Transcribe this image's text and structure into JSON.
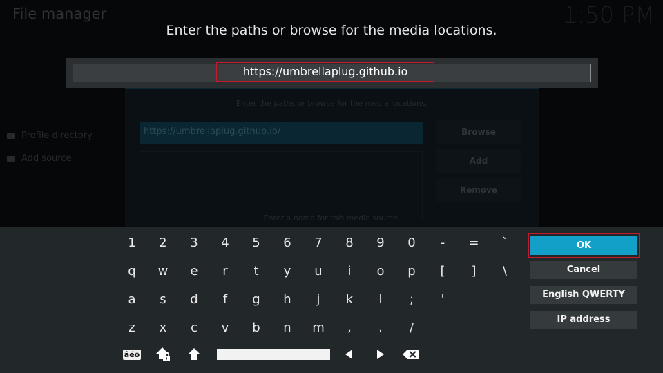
{
  "background": {
    "app_title": "File manager",
    "clock": "1:50 PM",
    "sidebar": [
      {
        "label": "Profile directory",
        "icon": "folder-icon"
      },
      {
        "label": "Add source",
        "icon": "folder-icon"
      }
    ],
    "dialog": {
      "hint": "Enter the paths or browse for the media locations.",
      "path": "https://umbrellaplug.github.io/",
      "buttons": {
        "browse": "Browse",
        "add": "Add",
        "remove": "Remove"
      },
      "name_hint": "Enter a name for this media source."
    }
  },
  "input": {
    "heading": "Enter the paths or browse for the media locations.",
    "value": "https://umbrellaplug.github.io"
  },
  "keyboard": {
    "rows": [
      [
        "1",
        "2",
        "3",
        "4",
        "5",
        "6",
        "7",
        "8",
        "9",
        "0",
        "-",
        "=",
        "`"
      ],
      [
        "q",
        "w",
        "e",
        "r",
        "t",
        "y",
        "u",
        "i",
        "o",
        "p",
        "[",
        "]",
        "\\"
      ],
      [
        "a",
        "s",
        "d",
        "f",
        "g",
        "h",
        "j",
        "k",
        "l",
        ";",
        "'"
      ],
      [
        "z",
        "x",
        "c",
        "v",
        "b",
        "n",
        "m",
        ",",
        ".",
        "/"
      ]
    ],
    "controls": {
      "symbols_label": "âéö",
      "caps_lock_icon": "caps-lock-icon",
      "shift_icon": "shift-icon",
      "space_icon": "space-bar",
      "left_icon": "arrow-left-icon",
      "right_icon": "arrow-right-icon",
      "backspace_icon": "backspace-icon"
    }
  },
  "actions": {
    "ok": "OK",
    "cancel": "Cancel",
    "layout": "English QWERTY",
    "ip": "IP address"
  },
  "colors": {
    "accent": "#12a0c8",
    "focus_outline": "#c41a2b",
    "panel": "#22272a"
  }
}
